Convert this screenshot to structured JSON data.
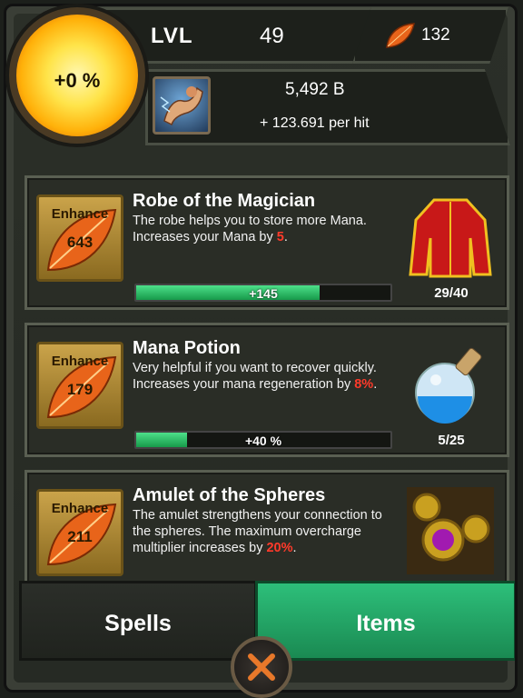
{
  "header": {
    "charge_percent": "+0 %",
    "level_label": "LVL",
    "level_value": "49",
    "leaf_count": "132",
    "gold_amount": "5,492 B",
    "per_hit": "+ 123.691 per hit"
  },
  "items": [
    {
      "enhance_label": "Enhance",
      "cost": "643",
      "title": "Robe of the Magician",
      "desc_before": "The robe helps you to store more Mana. Increases your Mana by ",
      "desc_highlight": "5",
      "desc_after": ".",
      "progress_label": "+145",
      "progress_fraction": 0.72,
      "count": "29/40",
      "icon": "red-robe-icon"
    },
    {
      "enhance_label": "Enhance",
      "cost": "179",
      "title": "Mana Potion",
      "desc_before": "Very helpful if you want to recover quickly. Increases your mana regeneration by ",
      "desc_highlight": "8%",
      "desc_after": ".",
      "progress_label": "+40 %",
      "progress_fraction": 0.2,
      "count": "5/25",
      "icon": "potion-flask-icon"
    },
    {
      "enhance_label": "Enhance",
      "cost": "211",
      "title": "Amulet of the Spheres",
      "desc_before": "The amulet strengthens your connection to the spheres. The maximum overcharge multiplier increases by ",
      "desc_highlight": "20%",
      "desc_after": ".",
      "icon": "amulet-icon"
    }
  ],
  "tabs": {
    "spells": "Spells",
    "items": "Items"
  },
  "colors": {
    "highlight_red": "#ff3a2a",
    "progress_green": "#2fcf70",
    "active_tab": "#22a866"
  }
}
